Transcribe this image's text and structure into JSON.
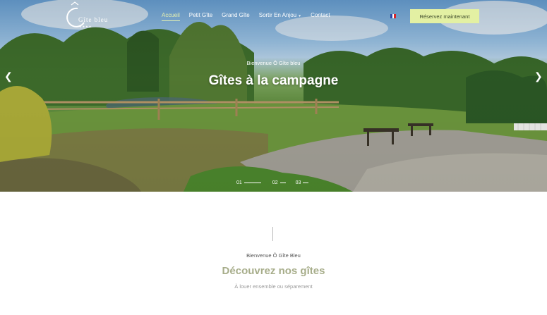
{
  "brand": {
    "name": "Gîte bleu",
    "stars": "★★★★"
  },
  "nav": {
    "items": [
      {
        "label": "Accueil"
      },
      {
        "label": "Petit Gîte"
      },
      {
        "label": "Grand Gîte"
      },
      {
        "label": "Sortir En Anjou"
      },
      {
        "label": "Contact"
      }
    ],
    "active_item": "Accueil",
    "language": "fr",
    "cta_label": "Réservez maintenant",
    "cta_color": "#e3f0a3"
  },
  "hero": {
    "kicker": "Bienvenue Ô Gîte bleu",
    "title": "Gîtes à la campagne",
    "slides": [
      "01",
      "02",
      "03"
    ],
    "active_slide": "01",
    "prev_icon": "chevron-left-icon",
    "next_icon": "chevron-right-icon"
  },
  "section": {
    "kicker": "Bienvenue Ô Gîte Bleu",
    "title": "Découvrez nos gîtes",
    "subtitle": "À louer ensemble ou séparement",
    "title_color": "#a7ad8a"
  }
}
